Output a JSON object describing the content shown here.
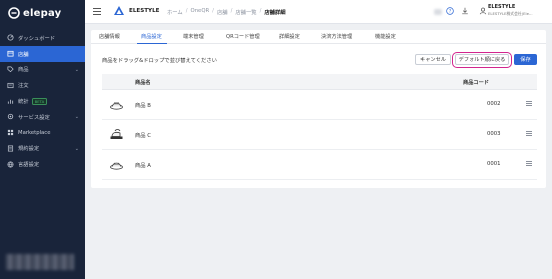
{
  "app": {
    "logo_text": "elepay",
    "brand_name": "ELESTYLE"
  },
  "sidebar": {
    "items": [
      {
        "label": "ダッシュボード",
        "icon": "dashboard-icon"
      },
      {
        "label": "店舗",
        "icon": "store-icon",
        "active": true
      },
      {
        "label": "商品",
        "icon": "tag-icon",
        "chevron": true
      },
      {
        "label": "注文",
        "icon": "cart-icon"
      },
      {
        "label": "統計",
        "icon": "chart-icon",
        "badge": "BETA"
      },
      {
        "label": "サービス設定",
        "icon": "service-icon",
        "chevron": true
      },
      {
        "label": "Marketplace",
        "icon": "marketplace-icon"
      },
      {
        "label": "規約設定",
        "icon": "terms-icon",
        "chevron": true
      },
      {
        "label": "言語設定",
        "icon": "language-icon"
      }
    ]
  },
  "header": {
    "breadcrumbs": [
      "ホーム",
      "OneQR",
      "店舗",
      "店舗一覧",
      "店舗詳細"
    ],
    "user_name": "ELESTYLE",
    "user_sub": "ELESTYLE株式会社(Ele..."
  },
  "tabs": [
    {
      "label": "店舗情報"
    },
    {
      "label": "商品設定",
      "active": true
    },
    {
      "label": "端末管理"
    },
    {
      "label": "QRコード管理"
    },
    {
      "label": "詳細設定"
    },
    {
      "label": "決済方法管理"
    },
    {
      "label": "機能設定"
    }
  ],
  "main": {
    "instruction": "商品をドラッグ&ドロップで並び替えてください",
    "cancel_label": "キャンセル",
    "default_label": "デフォルト順に戻る",
    "save_label": "保存"
  },
  "table": {
    "columns": {
      "name": "商品名",
      "code": "商品コード"
    },
    "rows": [
      {
        "name": "商品 B",
        "code": "0002"
      },
      {
        "name": "商品 C",
        "code": "0003"
      },
      {
        "name": "商品 A",
        "code": "0001"
      }
    ]
  },
  "colors": {
    "sidebar_bg": "#19243a",
    "accent": "#2b66d4",
    "highlight": "#d2258e"
  }
}
